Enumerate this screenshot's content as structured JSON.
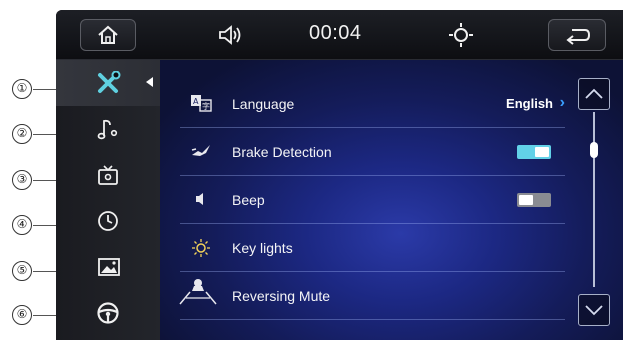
{
  "callouts": [
    "①",
    "②",
    "③",
    "④",
    "⑤",
    "⑥"
  ],
  "topbar": {
    "home_icon": "home-icon",
    "volume_icon": "volume-icon",
    "clock": "00:04",
    "brightness_icon": "brightness-icon",
    "back_icon": "back-icon"
  },
  "sidebar": {
    "items": [
      {
        "icon": "tools-icon",
        "active": true
      },
      {
        "icon": "music-note-icon",
        "active": false
      },
      {
        "icon": "tv-icon",
        "active": false
      },
      {
        "icon": "clock-icon",
        "active": false
      },
      {
        "icon": "picture-icon",
        "active": false
      },
      {
        "icon": "steering-wheel-icon",
        "active": false
      }
    ]
  },
  "settings": {
    "rows": [
      {
        "icon": "language-icon",
        "label": "Language",
        "value": "English",
        "control": "link"
      },
      {
        "icon": "brake-icon",
        "label": "Brake Detection",
        "control": "toggle",
        "state": "on"
      },
      {
        "icon": "speaker-icon",
        "label": "Beep",
        "control": "toggle",
        "state": "off"
      },
      {
        "icon": "key-light-icon",
        "label": "Key lights",
        "control": "none"
      },
      {
        "icon": "reversing-icon",
        "label": "Reversing Mute",
        "control": "none"
      }
    ]
  },
  "colors": {
    "toggle_on": "#62d1e8",
    "toggle_off": "#8a8c92",
    "accent_chevron": "#3aa0ff"
  }
}
